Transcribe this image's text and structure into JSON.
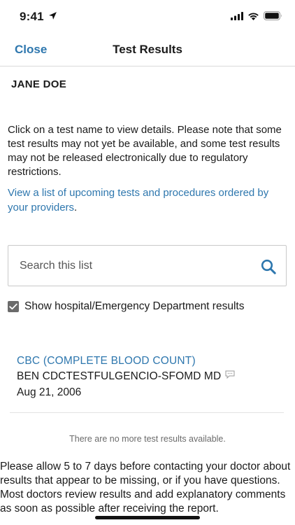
{
  "status_bar": {
    "time": "9:41"
  },
  "nav": {
    "close_label": "Close",
    "title": "Test Results"
  },
  "patient": {
    "name": "JANE DOE"
  },
  "intro_text": "Click on a test name to view details. Please note that some test results may not yet be available, and some test results may not be released electronically due to regulatory restrictions.",
  "upcoming": {
    "link_text": "View a list of upcoming tests and procedures ordered by your providers",
    "suffix": "."
  },
  "search": {
    "placeholder": "Search this list",
    "value": ""
  },
  "filter": {
    "label": "Show hospital/Emergency Department results",
    "checked": true
  },
  "results": [
    {
      "name": "CBC (COMPLETE BLOOD COUNT)",
      "provider": "BEN CDCTESTFULGENCIO-SFOMD MD",
      "date": "Aug 21, 2006"
    }
  ],
  "no_more_text": "There are no more test results available.",
  "footer_text": "Please allow 5 to 7 days before contacting your doctor about results that appear to be missing, or if you have questions. Most doctors review results and add explanatory comments as soon as possible after receiving the report.",
  "colors": {
    "link": "#2e77ae",
    "text": "#1a1a1a",
    "checkbox": "#6b6b6b"
  }
}
